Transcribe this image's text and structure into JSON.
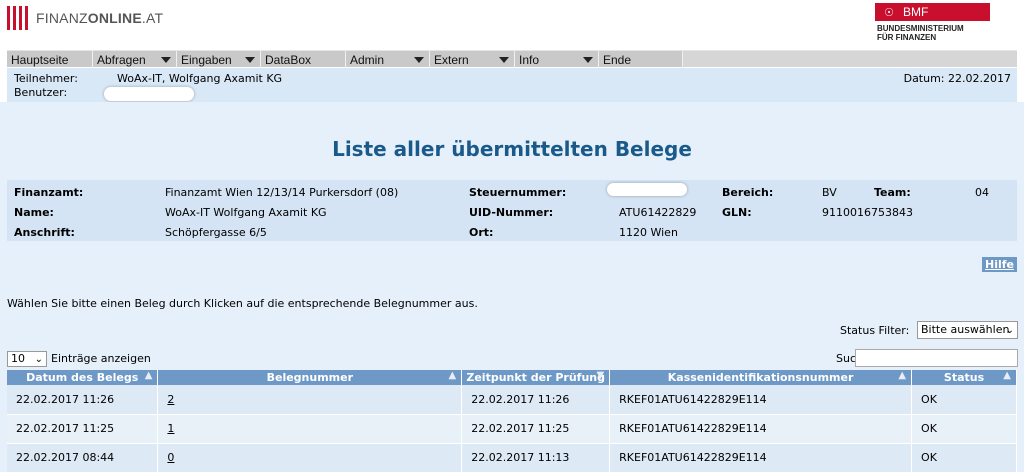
{
  "header": {
    "logo_light": "FINANZ",
    "logo_bold": "ONLINE",
    "logo_suffix": ".AT",
    "bmf_short": "BMF",
    "bmf_line1": "BUNDESMINISTERIUM",
    "bmf_line2": "FÜR FINANZEN"
  },
  "menu": [
    {
      "label": "Hauptseite"
    },
    {
      "label": "Abfragen"
    },
    {
      "label": "Eingaben"
    },
    {
      "label": "DataBox"
    },
    {
      "label": "Admin"
    },
    {
      "label": "Extern"
    },
    {
      "label": "Info"
    },
    {
      "label": "Ende"
    }
  ],
  "infobar": {
    "teilnehmer_label": "Teilnehmer:",
    "teilnehmer_value": "WoAx-IT, Wolfgang Axamit KG",
    "benutzer_label": "Benutzer:",
    "datum": "Datum: 22.02.2017"
  },
  "title": "Liste aller übermittelten Belege",
  "details": {
    "finanzamt_label": "Finanzamt:",
    "finanzamt_value": "Finanzamt Wien 12/13/14 Purkersdorf (08)",
    "name_label": "Name:",
    "name_value": "WoAx-IT Wolfgang Axamit KG",
    "anschrift_label": "Anschrift:",
    "anschrift_value": "Schöpfergasse 6/5",
    "steuernummer_label": "Steuernummer:",
    "uid_label": "UID-Nummer:",
    "uid_value": "ATU61422829",
    "ort_label": "Ort:",
    "ort_value": "1120 Wien",
    "bereich_label": "Bereich:",
    "bereich_value": "BV",
    "team_label": "Team:",
    "team_value": "04",
    "gln_label": "GLN:",
    "gln_value": "9110016753843"
  },
  "help_label": "Hilfe",
  "hint": "Wählen Sie bitte einen Beleg durch Klicken auf die entsprechende Belegnummer aus.",
  "filter": {
    "status_label": "Status Filter:",
    "status_selected": "Bitte auswählen",
    "length_selected": "10",
    "length_label": "Einträge anzeigen",
    "search_label": "Suchen"
  },
  "table": {
    "columns": [
      "Datum des Belegs",
      "Belegnummer",
      "Zeitpunkt der Prüfung",
      "Kassenidentifikationsnummer",
      "Status"
    ],
    "rows": [
      [
        "22.02.2017 11:26",
        "2",
        "22.02.2017 11:26",
        "RKEF01ATU61422829E114",
        "OK"
      ],
      [
        "22.02.2017 11:25",
        "1",
        "22.02.2017 11:25",
        "RKEF01ATU61422829E114",
        "OK"
      ],
      [
        "22.02.2017 08:44",
        "0",
        "22.02.2017 11:13",
        "RKEF01ATU61422829E114",
        "OK"
      ]
    ]
  },
  "colors": {
    "brand_red": "#c8102e",
    "title_blue": "#1a5a8a",
    "header_blue": "#6e98c6",
    "panel_blue": "#d4e4f4"
  }
}
